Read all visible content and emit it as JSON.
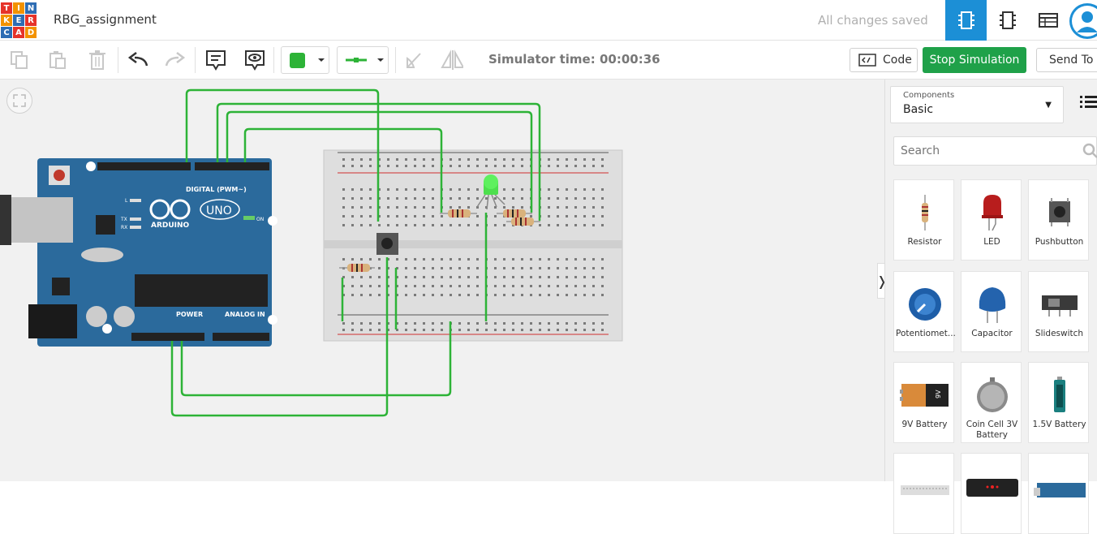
{
  "logo": {
    "letters": [
      "T",
      "I",
      "N",
      "K",
      "E",
      "R",
      "C",
      "A",
      "D"
    ],
    "colors": [
      "#e6332a",
      "#f39200",
      "#2e6db4",
      "#f39200",
      "#2e6db4",
      "#e6332a",
      "#2e6db4",
      "#e6332a",
      "#f39200"
    ]
  },
  "header": {
    "project_title": "RBG_assignment",
    "save_status": "All changes saved"
  },
  "toolbar": {
    "simulator_time": "Simulator time: 00:00:36",
    "code_label": "Code",
    "stop_label": "Stop Simulation",
    "send_label": "Send To",
    "wire_color": "#2db337"
  },
  "panel": {
    "components_label": "Components",
    "components_value": "Basic",
    "search_placeholder": "Search",
    "items": [
      {
        "label": "Resistor"
      },
      {
        "label": "LED"
      },
      {
        "label": "Pushbutton"
      },
      {
        "label": "Potentiomet..."
      },
      {
        "label": "Capacitor"
      },
      {
        "label": "Slideswitch"
      },
      {
        "label": "9V Battery"
      },
      {
        "label": "Coin Cell 3V Battery"
      },
      {
        "label": "1.5V Battery"
      }
    ]
  },
  "board": {
    "brand": "ARDUINO",
    "model": "UNO",
    "digital_label": "DIGITAL (PWM~)",
    "power_label": "POWER",
    "analog_label": "ANALOG IN",
    "on_label": "ON",
    "tx_label": "TX",
    "rx_label": "RX",
    "l_label": "L"
  }
}
